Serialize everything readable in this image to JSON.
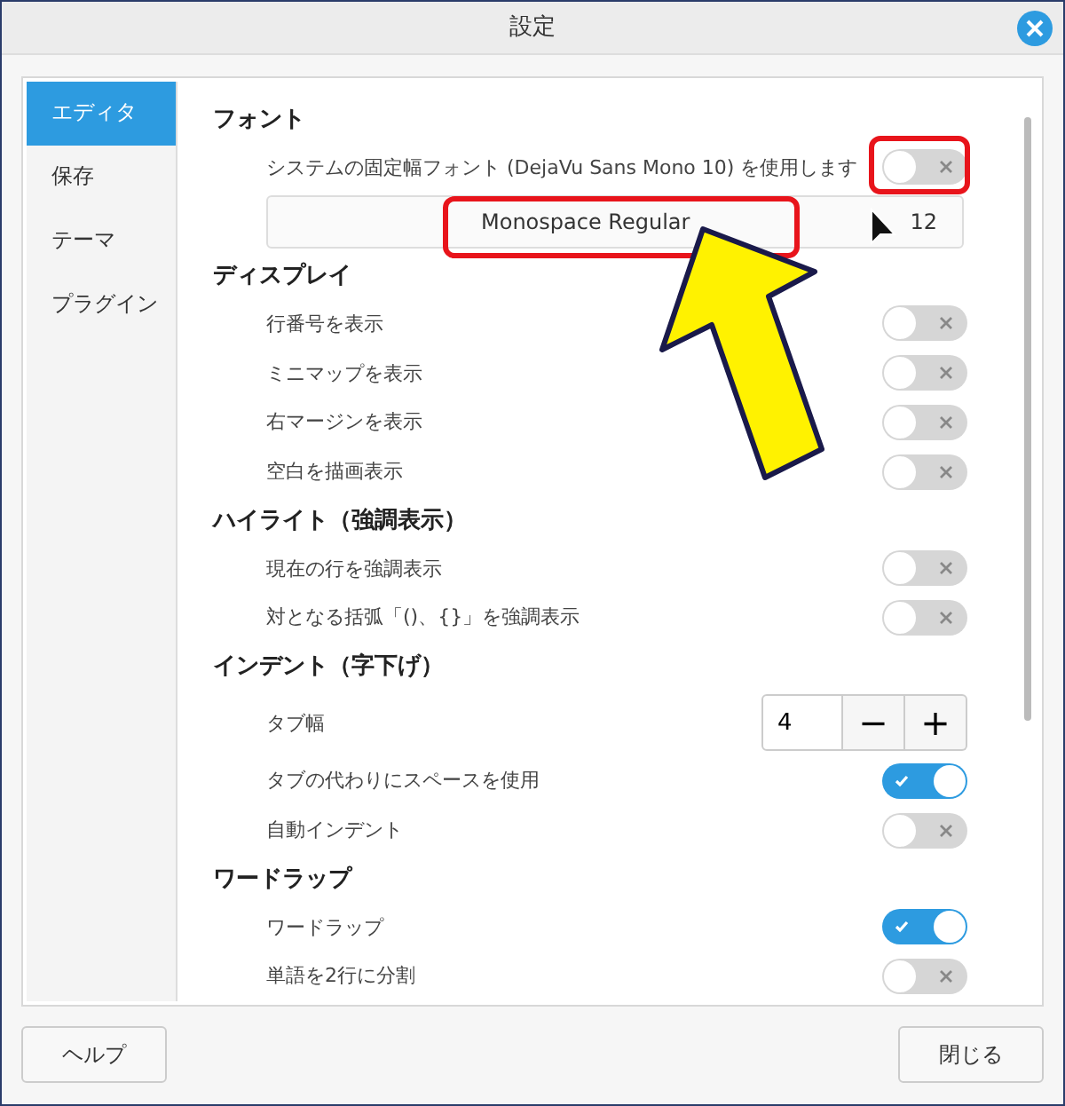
{
  "window": {
    "title": "設定"
  },
  "sidebar": {
    "items": [
      {
        "label": "エディタ",
        "selected": true
      },
      {
        "label": "保存",
        "selected": false
      },
      {
        "label": "テーマ",
        "selected": false
      },
      {
        "label": "プラグイン",
        "selected": false
      }
    ]
  },
  "sections": [
    {
      "title": "フォント",
      "rows": [
        {
          "kind": "toggle",
          "label": "システムの固定幅フォント (DejaVu Sans Mono 10) を使用します",
          "on": false
        },
        {
          "kind": "font",
          "font": "Monospace Regular",
          "size": "12"
        }
      ]
    },
    {
      "title": "ディスプレイ",
      "rows": [
        {
          "kind": "toggle",
          "label": "行番号を表示",
          "on": false
        },
        {
          "kind": "toggle",
          "label": "ミニマップを表示",
          "on": false
        },
        {
          "kind": "toggle",
          "label": "右マージンを表示",
          "on": false
        },
        {
          "kind": "toggle",
          "label": "空白を描画表示",
          "on": false
        }
      ]
    },
    {
      "title": "ハイライト（強調表示）",
      "rows": [
        {
          "kind": "toggle",
          "label": "現在の行を強調表示",
          "on": false
        },
        {
          "kind": "toggle",
          "label": "対となる括弧「()、{}」を強調表示",
          "on": false
        }
      ]
    },
    {
      "title": "インデント（字下げ）",
      "rows": [
        {
          "kind": "spin",
          "label": "タブ幅",
          "value": "4",
          "minus": "−",
          "plus": "+"
        },
        {
          "kind": "toggle",
          "label": "タブの代わりにスペースを使用",
          "on": true
        },
        {
          "kind": "toggle",
          "label": "自動インデント",
          "on": false
        }
      ]
    },
    {
      "title": "ワードラップ",
      "rows": [
        {
          "kind": "toggle",
          "label": "ワードラップ",
          "on": true
        },
        {
          "kind": "toggle",
          "label": "単語を2行に分割",
          "on": false
        }
      ]
    }
  ],
  "buttons": {
    "help": "ヘルプ",
    "close": "閉じる"
  }
}
